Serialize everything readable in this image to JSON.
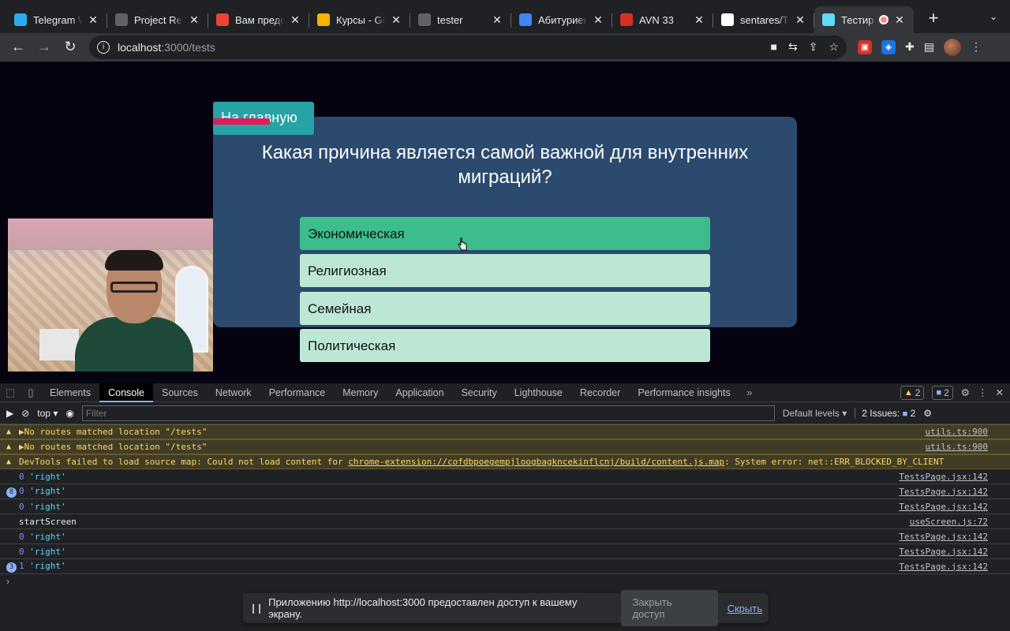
{
  "browser": {
    "tabs": [
      {
        "title": "Telegram Web",
        "favicon": "telegram-icon",
        "color": "#2aabee"
      },
      {
        "title": "Project React",
        "favicon": "page-icon",
        "color": "#5f6368"
      },
      {
        "title": "Вам предоставлен",
        "favicon": "gmail-icon",
        "color": "#ea4335"
      },
      {
        "title": "Курсы - Google",
        "favicon": "slides-icon",
        "color": "#f4b400"
      },
      {
        "title": "tester",
        "favicon": "page-icon",
        "color": "#5f6368"
      },
      {
        "title": "Абитуриент",
        "favicon": "abiturient-icon",
        "color": "#4285f4"
      },
      {
        "title": "AVN 33",
        "favicon": "avn-icon",
        "color": "#d93025"
      },
      {
        "title": "sentares/Te",
        "favicon": "github-icon",
        "color": "#ffffff"
      },
      {
        "title": "Тестир",
        "favicon": "react-icon",
        "color": "#61dafb"
      }
    ],
    "new_tab_label": "+",
    "url_host": "localhost",
    "url_path": ":3000/tests"
  },
  "page": {
    "home_button": "На главную",
    "question": "Какая причина является самой важной для внутренних миграций?",
    "answers": [
      {
        "label": "Экономическая",
        "selected": true
      },
      {
        "label": "Религиозная",
        "selected": false
      },
      {
        "label": "Семейная",
        "selected": false
      },
      {
        "label": "Политическая",
        "selected": false
      }
    ]
  },
  "devtools": {
    "tabs": [
      "Elements",
      "Console",
      "Sources",
      "Network",
      "Performance",
      "Memory",
      "Application",
      "Security",
      "Lighthouse",
      "Recorder",
      "Performance insights"
    ],
    "active_tab": "Console",
    "warnings_count": "2",
    "messages_count": "2",
    "context": "top",
    "filter_placeholder": "Filter",
    "levels": "Default levels",
    "issues_label": "2 Issues:",
    "issues_count": "2",
    "console": [
      {
        "type": "warn",
        "text": "▶No routes matched location \"/tests\"",
        "src": "utils.ts:900"
      },
      {
        "type": "warn",
        "text": "▶No routes matched location \"/tests\"",
        "src": "utils.ts:900"
      },
      {
        "type": "warn-link",
        "text_pre": "DevTools failed to load source map: Could not load content for ",
        "link": "chrome-extension://cofdbpoegempjloogbagkncekinflcnj/build/content.js.map",
        "text_post": ": System error: net::ERR_BLOCKED_BY_CLIENT",
        "src": ""
      },
      {
        "type": "log",
        "count": "",
        "num": "0",
        "str": "'right'",
        "src": "TestsPage.jsx:142"
      },
      {
        "type": "log",
        "count": "8",
        "num": "0",
        "str": "'right'",
        "src": "TestsPage.jsx:142"
      },
      {
        "type": "log",
        "count": "",
        "num": "0",
        "str": "'right'",
        "src": "TestsPage.jsx:142"
      },
      {
        "type": "plain",
        "text": "startScreen",
        "src": "useScreen.js:72"
      },
      {
        "type": "log",
        "count": "",
        "num": "0",
        "str": "'right'",
        "src": "TestsPage.jsx:142"
      },
      {
        "type": "log",
        "count": "",
        "num": "0",
        "str": "'right'",
        "src": "TestsPage.jsx:142"
      },
      {
        "type": "log",
        "count": "3",
        "num": "1",
        "str": "'right'",
        "src": "TestsPage.jsx:142"
      }
    ],
    "prompt": "›"
  },
  "share_bar": {
    "message": "Приложению http://localhost:3000 предоставлен доступ к вашему экрану.",
    "stop_label": "Закрыть доступ",
    "hide_label": "Скрыть"
  }
}
